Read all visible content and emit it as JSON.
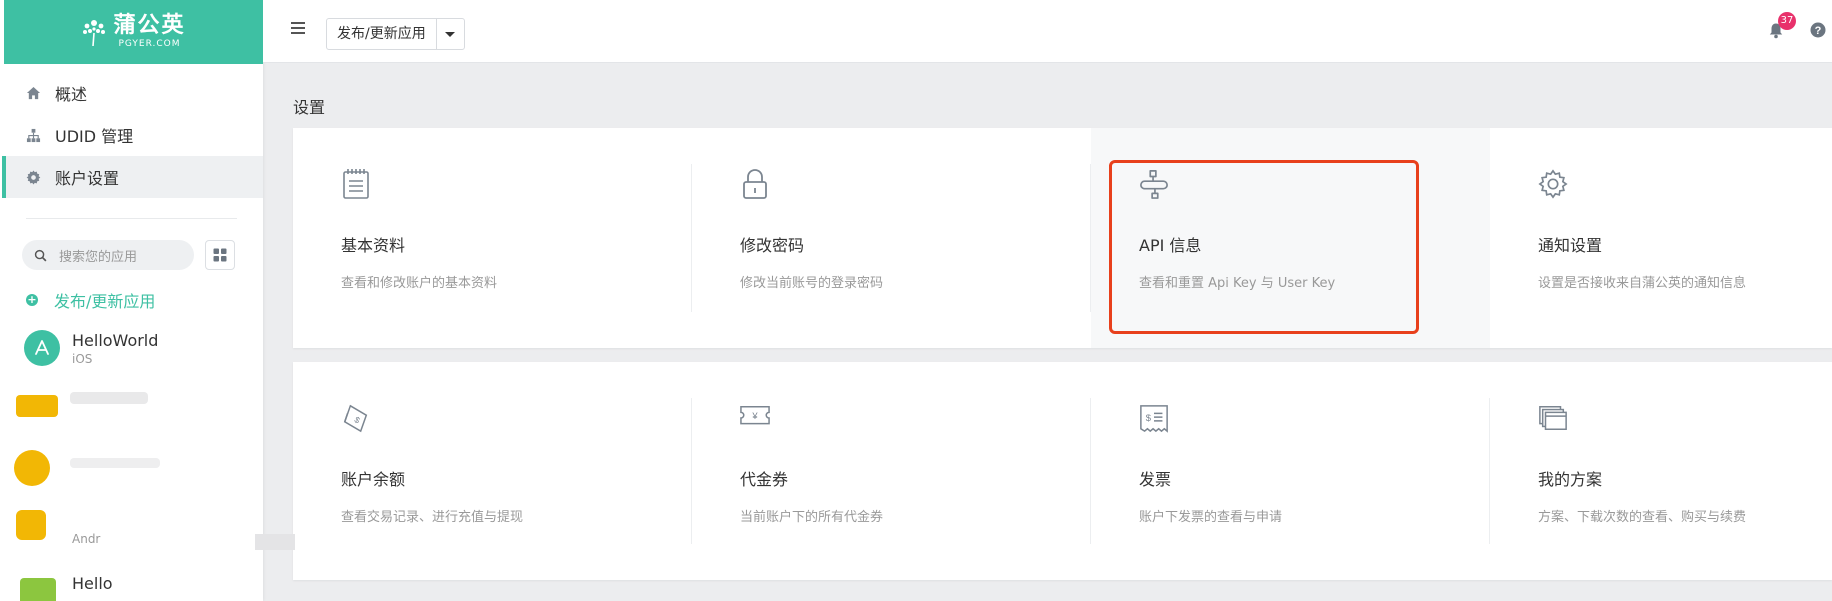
{
  "brand": {
    "name_cn": "蒲公英",
    "name_en": "PGYER.COM",
    "color": "#3ec0a3"
  },
  "sidebar": {
    "nav": [
      {
        "label": "概述",
        "icon": "home-icon"
      },
      {
        "label": "UDID 管理",
        "icon": "sitemap-icon"
      },
      {
        "label": "账户设置",
        "icon": "gear-icon",
        "active": true
      }
    ],
    "search": {
      "placeholder": "搜索您的应用"
    },
    "publish_label": "发布/更新应用",
    "apps": [
      {
        "name": "HelloWorld",
        "platform": "iOS"
      },
      {
        "name": "",
        "platform": "Andr"
      },
      {
        "name": "Hello",
        "platform": ""
      }
    ]
  },
  "header": {
    "app_select": "发布/更新应用",
    "notification_count": "37"
  },
  "main": {
    "title": "设置",
    "cards_row1": [
      {
        "title": "基本资料",
        "desc": "查看和修改账户的基本资料",
        "icon": "notepad-icon"
      },
      {
        "title": "修改密码",
        "desc": "修改当前账号的登录密码",
        "icon": "lock-icon"
      },
      {
        "title": "API 信息",
        "desc": "查看和重置 Api Key 与 User Key",
        "icon": "api-plug-icon",
        "highlighted": true
      },
      {
        "title": "通知设置",
        "desc": "设置是否接收来自蒲公英的通知信息",
        "icon": "cog-icon"
      }
    ],
    "cards_row2": [
      {
        "title": "账户余额",
        "desc": "查看交易记录、进行充值与提现",
        "icon": "money-note-icon"
      },
      {
        "title": "代金券",
        "desc": "当前账户下的所有代金券",
        "icon": "voucher-icon"
      },
      {
        "title": "发票",
        "desc": "账户下发票的查看与申请",
        "icon": "invoice-icon"
      },
      {
        "title": "我的方案",
        "desc": "方案、下载次数的查看、购买与续费",
        "icon": "plans-icon"
      }
    ]
  },
  "colors": {
    "highlight": "#e8401c",
    "badge": "#e8316b"
  }
}
